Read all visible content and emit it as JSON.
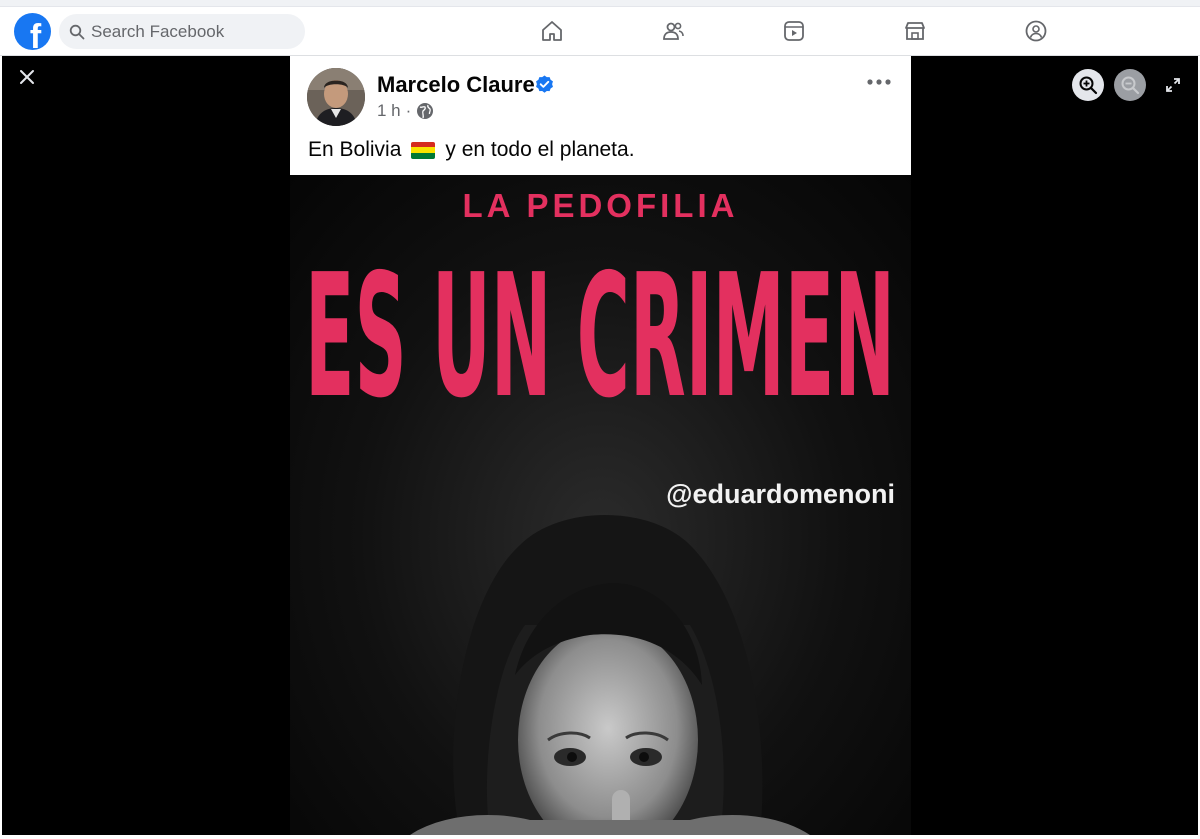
{
  "header": {
    "search_placeholder": "Search Facebook",
    "nav": [
      {
        "name": "home-icon"
      },
      {
        "name": "friends-icon"
      },
      {
        "name": "watch-icon"
      },
      {
        "name": "marketplace-icon"
      },
      {
        "name": "groups-icon"
      }
    ]
  },
  "viewer": {
    "controls": [
      "close-icon",
      "zoom-in-icon",
      "zoom-out-icon",
      "fullscreen-icon"
    ]
  },
  "post": {
    "author": "Marcelo Claure",
    "time": "1 h",
    "separator": "·",
    "text_before_flag": "En Bolivia",
    "text_after_flag": "y en todo el planeta.",
    "flag_colors": [
      "#d52b1e",
      "#f9e300",
      "#007934"
    ]
  },
  "image": {
    "kicker": "LA PEDOFILIA",
    "headline": "ES UN CRIMEN",
    "handle": "@eduardomenoni",
    "accent": "#e3305f"
  },
  "colors": {
    "brand": "#1877f2",
    "verified": "#1877f2"
  }
}
